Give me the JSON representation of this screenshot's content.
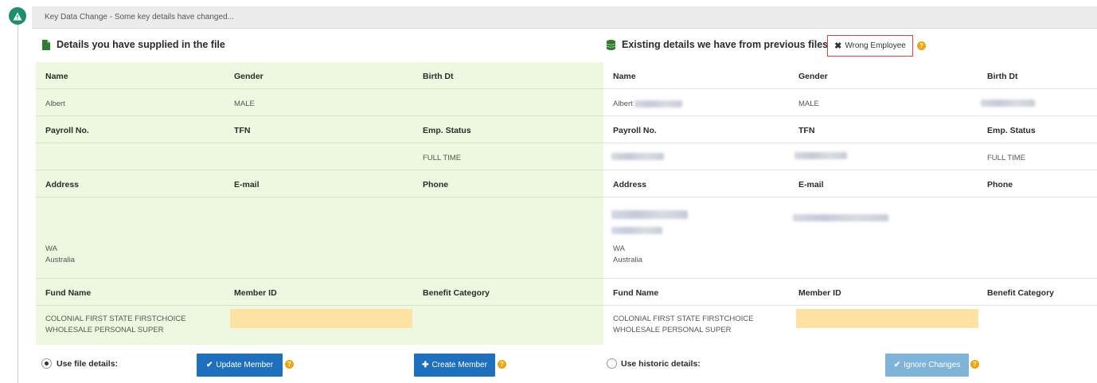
{
  "banner": {
    "text": "Key Data Change - Some key details have changed..."
  },
  "left": {
    "title": "Details you have supplied in the file",
    "rows": [
      {
        "type": "hdr",
        "cells": [
          "Name",
          "Gender",
          "Birth Dt"
        ]
      },
      {
        "type": "val",
        "cells": [
          "Albert",
          "MALE",
          ""
        ]
      },
      {
        "type": "hdr",
        "cells": [
          "Payroll No.",
          "TFN",
          "Emp. Status"
        ]
      },
      {
        "type": "val",
        "cells": [
          "",
          "",
          "FULL TIME"
        ]
      },
      {
        "type": "hdr",
        "cells": [
          "Address",
          "E-mail",
          "Phone"
        ]
      },
      {
        "type": "addr",
        "state": "WA",
        "country": "Australia"
      },
      {
        "type": "hdr",
        "cells": [
          "Fund Name",
          "Member ID",
          "Benefit Category"
        ]
      },
      {
        "type": "fund",
        "fund_line1": "COLONIAL FIRST STATE FIRSTCHOICE",
        "fund_line2": "WHOLESALE PERSONAL SUPER"
      }
    ]
  },
  "right": {
    "title": "Existing details we have from previous files",
    "wrong_employee_label": "Wrong Employee",
    "name": "Albert",
    "gender": "MALE",
    "emp_status": "FULL TIME",
    "state": "WA",
    "country": "Australia",
    "fund_line1": "COLONIAL FIRST STATE FIRSTCHOICE",
    "fund_line2": "WHOLESALE PERSONAL SUPER",
    "headers": {
      "name": "Name",
      "gender": "Gender",
      "birth": "Birth Dt",
      "payroll": "Payroll No.",
      "tfn": "TFN",
      "status": "Emp. Status",
      "address": "Address",
      "email": "E-mail",
      "phone": "Phone",
      "fund": "Fund Name",
      "member": "Member ID",
      "benefit": "Benefit Category"
    }
  },
  "footer": {
    "use_file_label": "Use file details:",
    "update_label": "Update Member",
    "create_label": "Create Member",
    "use_historic_label": "Use historic details:",
    "ignore_label": "Ignore Changes",
    "help_glyph": "?"
  }
}
